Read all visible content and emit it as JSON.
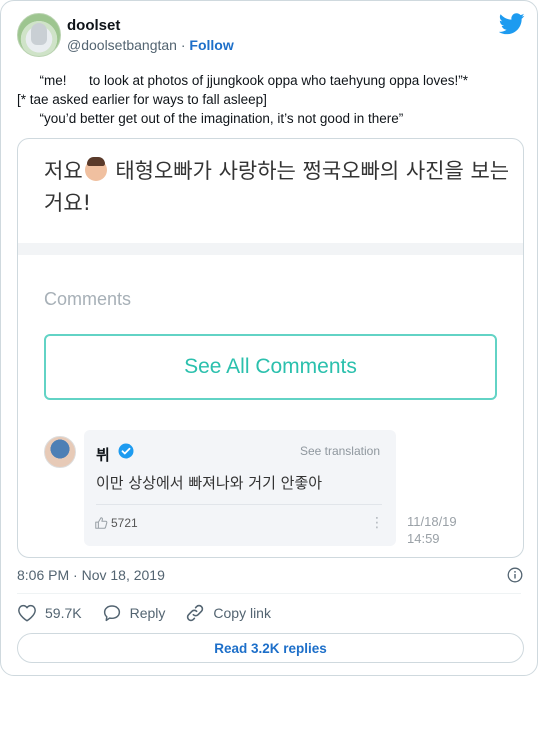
{
  "author": {
    "display_name": "doolset",
    "handle": "@doolsetbangtan",
    "separator": "·",
    "follow_label": "Follow"
  },
  "tweet": {
    "lines": [
      "      “me!      to look at photos of jjungkook oppa who taehyung oppa loves!”*",
      "[* tae asked earlier for ways to fall asleep]",
      "      “you’d better get out of the imagination, it’s not good in there”"
    ]
  },
  "embed": {
    "title_before_emoji": "저요",
    "title_after_emoji": " 태형오빠가 사랑하는 쩡국오빠의 사진을 보는 거요!",
    "comments_label": "Comments",
    "see_all_label": "See All Comments",
    "comment": {
      "name": "뷔",
      "see_translation": "See translation",
      "text": "이만 상상에서 빠져나와 거기 안좋아",
      "likes": "5721",
      "more": "⋮",
      "date": "11/18/19\n14:59"
    }
  },
  "meta": {
    "timestamp": "8:06 PM · Nov 18, 2019"
  },
  "actions": {
    "likes": "59.7K",
    "reply": "Reply",
    "copy_link": "Copy link"
  },
  "read_replies": "Read 3.2K replies",
  "colors": {
    "twitter_blue": "#1d9bf0",
    "link_blue": "#1d6fc9",
    "mint": "#2bc0ad"
  }
}
